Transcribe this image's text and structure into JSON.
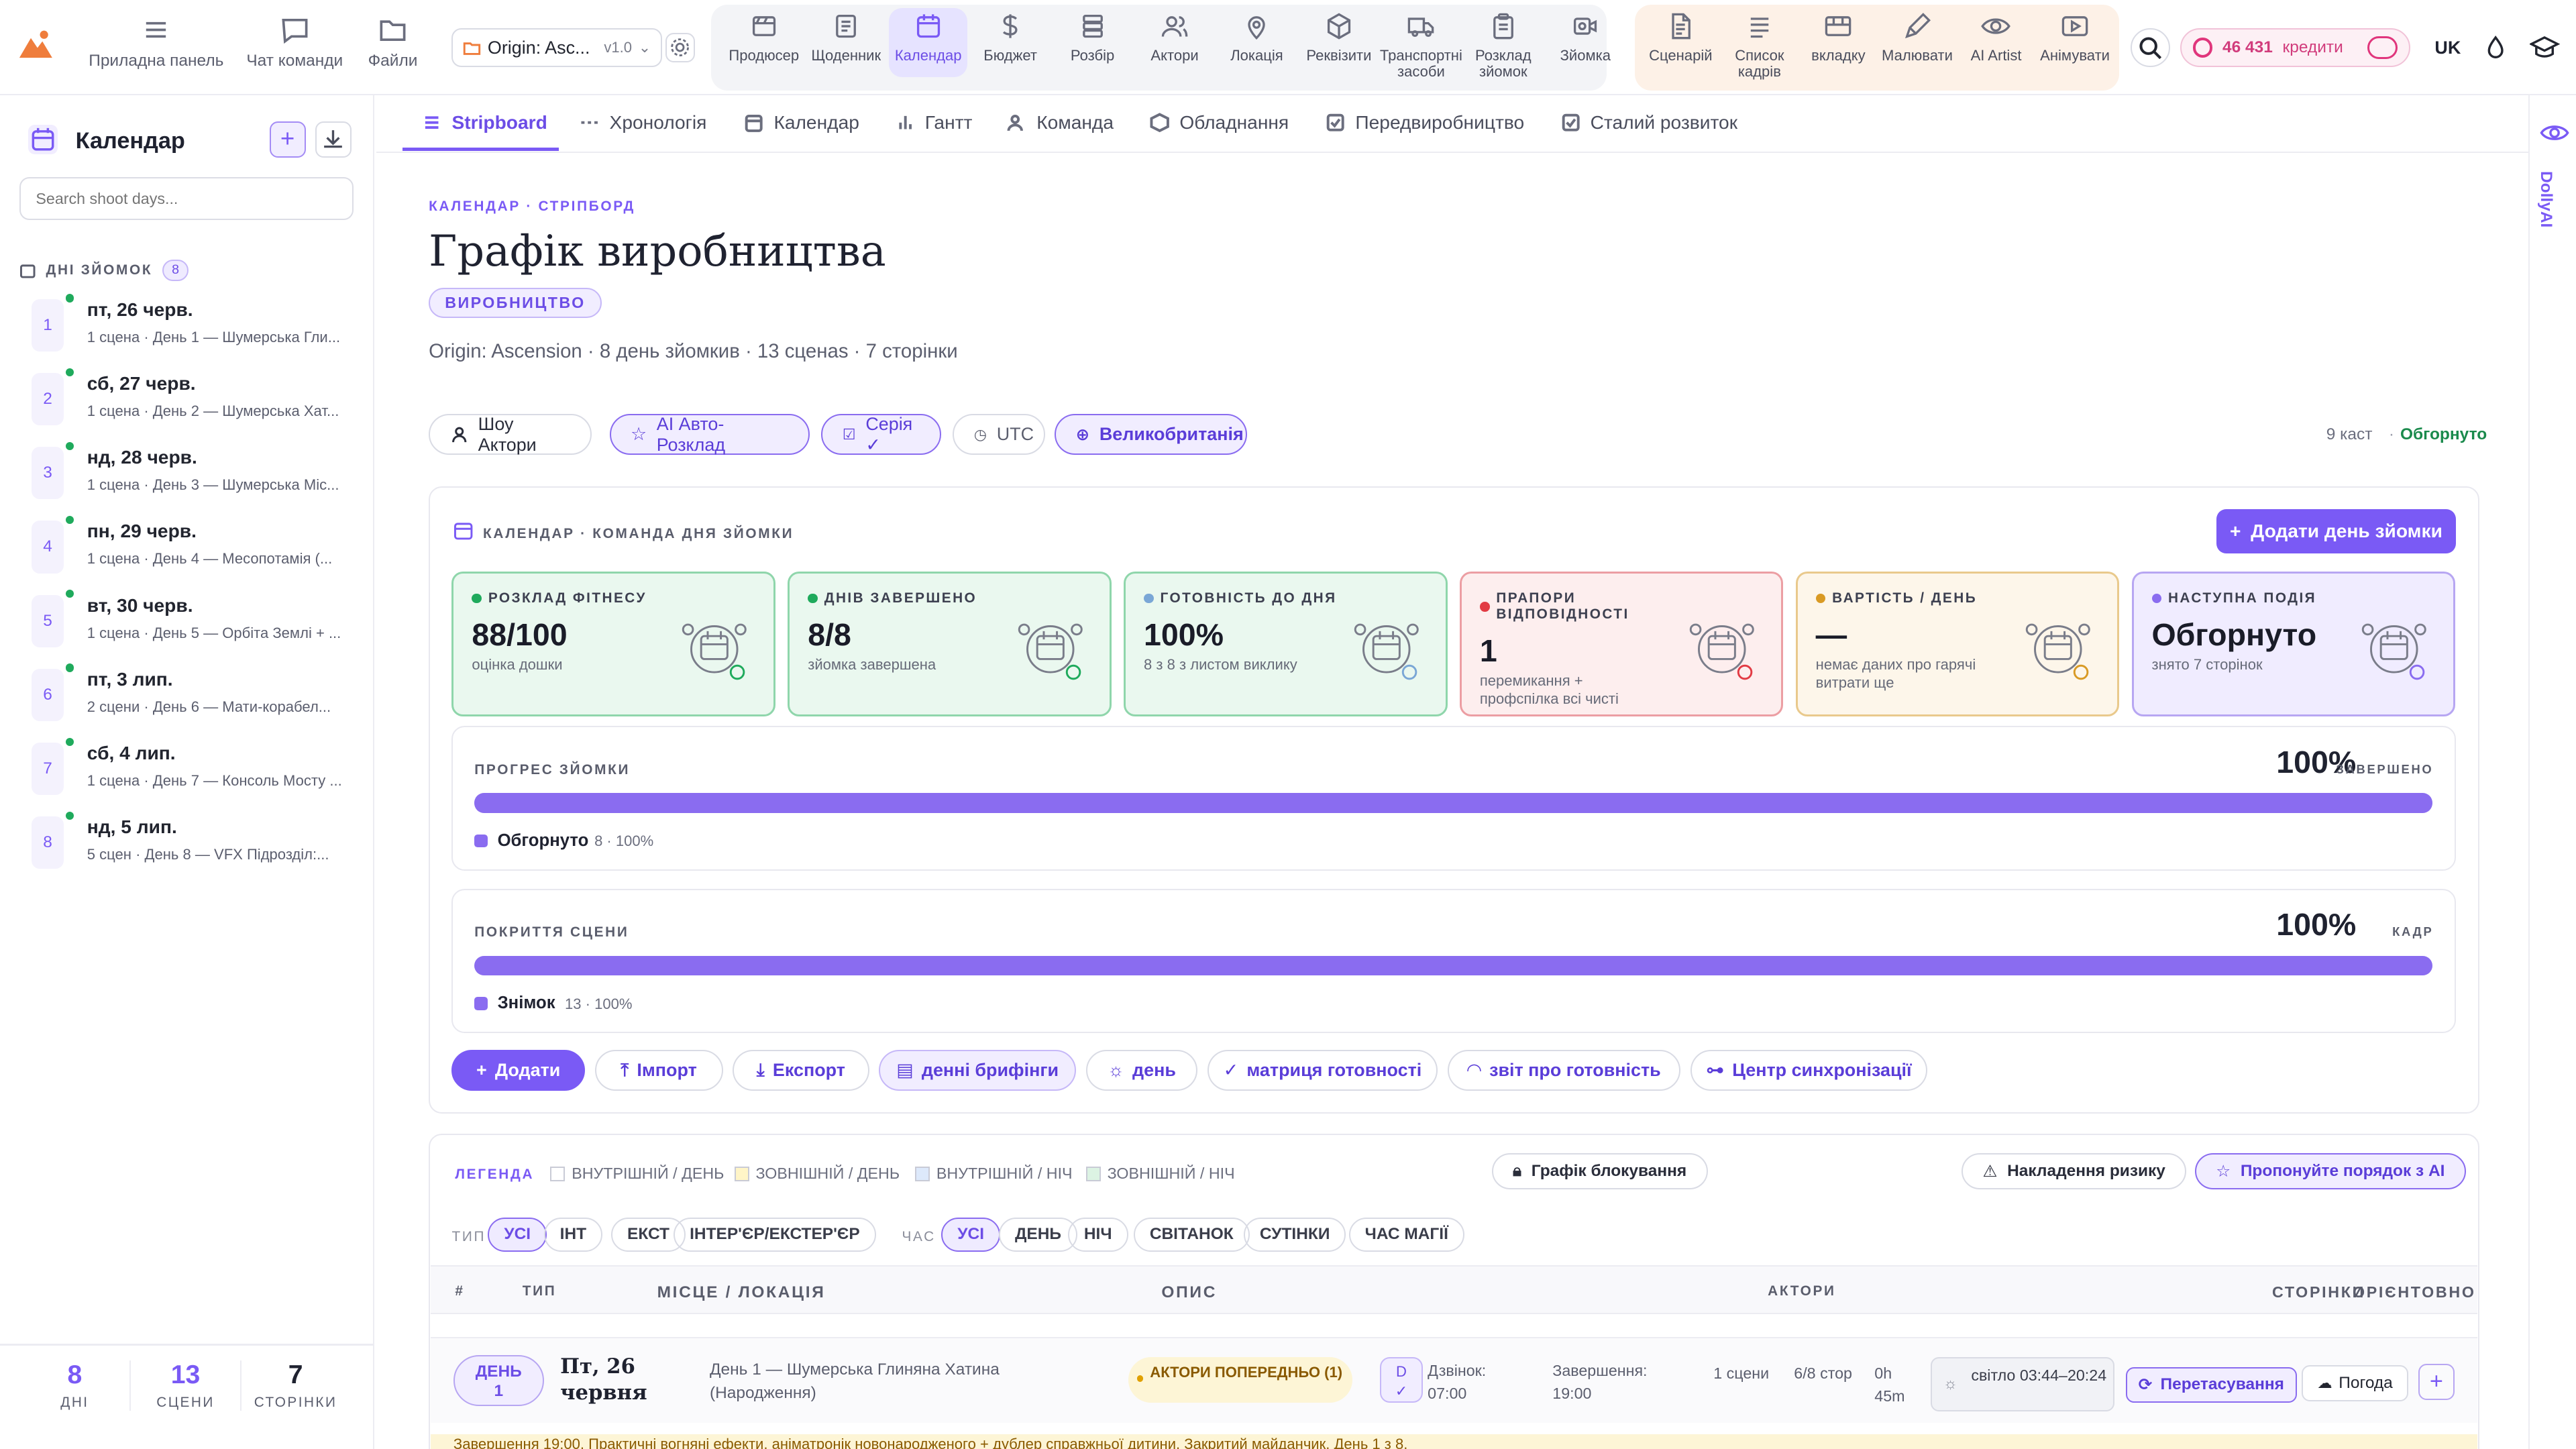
{
  "topbar": {
    "nav": [
      {
        "label": "Приладна панель",
        "icon": "menu-icon"
      },
      {
        "label": "Чат команди",
        "icon": "chat-icon"
      },
      {
        "label": "Файли",
        "icon": "folder-icon"
      }
    ],
    "project": {
      "name": "Origin: Asc...",
      "version": "v1.0"
    },
    "tools": [
      {
        "label": "Продюсер",
        "icon": "producer-icon"
      },
      {
        "label": "Щоденник",
        "icon": "journal-icon"
      },
      {
        "label": "Календар",
        "icon": "calendar-icon"
      },
      {
        "label": "Бюджет",
        "icon": "dollar-icon"
      },
      {
        "label": "Розбір",
        "icon": "breakdown-icon"
      },
      {
        "label": "Актори",
        "icon": "people-icon"
      },
      {
        "label": "Локація",
        "icon": "pin-icon"
      },
      {
        "label": "Реквізити",
        "icon": "box-icon"
      },
      {
        "label": "Транспортні засоби",
        "icon": "truck-icon"
      },
      {
        "label": "Розклад зйомок",
        "icon": "clipboard-icon"
      },
      {
        "label": "Зйомка",
        "icon": "camera-icon"
      }
    ],
    "writing": [
      {
        "label": "Сценарій",
        "icon": "script-icon"
      },
      {
        "label": "Список кадрів",
        "icon": "list-icon"
      },
      {
        "label": "вкладку",
        "icon": "storyboard-icon"
      },
      {
        "label": "Малювати",
        "icon": "pencil-icon"
      },
      {
        "label": "AI Artist",
        "icon": "eye-icon"
      },
      {
        "label": "Анімувати",
        "icon": "play-icon"
      }
    ],
    "credits": "46 431",
    "credits_label": "кредити",
    "lang": "UK"
  },
  "sidebar": {
    "title": "Календар",
    "search_placeholder": "Search shoot days...",
    "section": "ДНІ ЗЙОМОК",
    "count": "8",
    "days": [
      {
        "n": "1",
        "date": "пт, 26 черв.",
        "desc": "1 сцена · День 1 — Шумерська Гли..."
      },
      {
        "n": "2",
        "date": "сб, 27 черв.",
        "desc": "1 сцена · День 2 — Шумерська Хат..."
      },
      {
        "n": "3",
        "date": "нд, 28 черв.",
        "desc": "1 сцена · День 3 — Шумерська Міс..."
      },
      {
        "n": "4",
        "date": "пн, 29 черв.",
        "desc": "1 сцена · День 4 — Месопотамія (..."
      },
      {
        "n": "5",
        "date": "вт, 30 черв.",
        "desc": "1 сцена · День 5 — Орбіта Землі + ..."
      },
      {
        "n": "6",
        "date": "пт, 3 лип.",
        "desc": "2 сцени · День 6 — Мати-корабел..."
      },
      {
        "n": "7",
        "date": "сб, 4 лип.",
        "desc": "1 сцена · День 7 — Консоль Мосту ..."
      },
      {
        "n": "8",
        "date": "нд, 5 лип.",
        "desc": "5 сцен · День 8 — VFX Підрозділ:..."
      }
    ],
    "stats": [
      {
        "v": "8",
        "l": "ДНІ"
      },
      {
        "v": "13",
        "l": "СЦЕНИ"
      },
      {
        "v": "7",
        "l": "СТОРІНКИ"
      }
    ]
  },
  "tabs": [
    {
      "label": "Stripboard",
      "icon": "stripboard-icon"
    },
    {
      "label": "Хронологія",
      "icon": "dots-icon"
    },
    {
      "label": "Календар",
      "icon": "calendar-icon"
    },
    {
      "label": "Гантт",
      "icon": "bars-icon"
    },
    {
      "label": "Команда",
      "icon": "people-icon"
    },
    {
      "label": "Обладнання",
      "icon": "box-icon"
    },
    {
      "label": "Передвиробництво",
      "icon": "check-icon"
    },
    {
      "label": "Сталий розвиток",
      "icon": "check-icon"
    }
  ],
  "header": {
    "eyebrow": "КАЛЕНДАР · СТРІПБОРД",
    "title": "Графік виробництва",
    "badge": "ВИРОБНИЦТВО",
    "meta": "Origin: Ascension · 8 день зйомкив · 13 сценаs · 7 сторінки"
  },
  "controls": {
    "cast": "Шоу Актори",
    "auto": "AI Авто-Розклад",
    "series": "Серія ✓",
    "utc": "UTC",
    "region": "Великобританія",
    "cast_count": "9 каст",
    "status": "Обгорнуто"
  },
  "panel": {
    "title": "КАЛЕНДАР · КОМАНДА ДНЯ ЗЙОМКИ",
    "add": "Додати день зйомки"
  },
  "kpis": [
    {
      "h": "РОЗКЛАД ФІТНЕСУ",
      "v": "88/100",
      "s": "оцінка дошки",
      "bg": "#eaf8ef",
      "bd": "#8fd6ab",
      "dot": "#1faa5c"
    },
    {
      "h": "ДНІВ ЗАВЕРШЕНО",
      "v": "8/8",
      "s": "зйомка завершена",
      "bg": "#eaf8ef",
      "bd": "#8fd6ab",
      "dot": "#1faa5c"
    },
    {
      "h": "ГОТОВНІСТЬ ДО ДНЯ",
      "v": "100%",
      "s": "8 з 8 з листом виклику",
      "bg": "#eaf8ef",
      "bd": "#8fd6ab",
      "dot": "#7aa7d6"
    },
    {
      "h": "ПРАПОРИ ВІДПОВІДНОСТІ",
      "v": "1",
      "s": "перемикання + профспілка всі чисті",
      "bg": "#fdeeee",
      "bd": "#ec9ea3",
      "dot": "#e23b44"
    },
    {
      "h": "ВАРТІСТЬ / ДЕНЬ",
      "v": "—",
      "s": "немає даних про гарячі витрати ще",
      "bg": "#fdf6ea",
      "bd": "#e9c98c",
      "dot": "#d99a24"
    },
    {
      "h": "НАСТУПНА ПОДІЯ",
      "v": "Обгорнуто",
      "s": "знято 7 сторінок",
      "bg": "#f0ecff",
      "bd": "#b7a6f2",
      "dot": "#8a6cf0"
    }
  ],
  "progress": [
    {
      "label": "ПРОГРЕС ЗЙОМКИ",
      "pct": "100%",
      "suffix": "ЗАВЕРШЕНО",
      "legend": "Обгорнуто",
      "legend_meta": "8 · 100%",
      "value": 1.0
    },
    {
      "label": "ПОКРИТТЯ СЦЕНИ",
      "pct": "100%",
      "suffix": "КАДР",
      "legend": "Знімок",
      "legend_meta": "13 · 100%",
      "value": 1.0
    }
  ],
  "actions": [
    {
      "label": "Додати",
      "icon": "plus-icon"
    },
    {
      "label": "Імпорт",
      "icon": "upload-icon"
    },
    {
      "label": "Експорт",
      "icon": "download-icon"
    },
    {
      "label": "денні брифінги",
      "icon": "clipboard-icon"
    },
    {
      "label": "день",
      "icon": "sun-icon"
    },
    {
      "label": "матриця готовності",
      "icon": "check-circle-icon"
    },
    {
      "label": "звіт про готовність",
      "icon": "gauge-icon"
    },
    {
      "label": "Центр синхронізації",
      "icon": "link-icon"
    }
  ],
  "legend": {
    "title": "ЛЕГЕНДА",
    "items": [
      {
        "l": "ВНУТРІШНІЙ / ДЕНЬ",
        "c": "#ffffff"
      },
      {
        "l": "ЗОВНІШНІЙ / ДЕНЬ",
        "c": "#fff5c7"
      },
      {
        "l": "ВНУТРІШНІЙ / НІЧ",
        "c": "#dde9fb"
      },
      {
        "l": "ЗОВНІШНІЙ / НІЧ",
        "c": "#dcf3e3"
      }
    ],
    "block": "Графік блокування",
    "risk": "Накладення ризику",
    "suggest": "Пропонуйте порядок з AI"
  },
  "filters": {
    "type_label": "ТИП",
    "types": [
      "УСІ",
      "ІНТ",
      "ЕКСТ",
      "ІНТЕР'ЄР/ЕКСТЕР'ЄР"
    ],
    "time_label": "ЧАС",
    "times": [
      "УСІ",
      "ДЕНЬ",
      "НІЧ",
      "СВІТАНОК",
      "СУТІНКИ",
      "ЧАС МАГІЇ"
    ]
  },
  "table": {
    "cols": [
      "#",
      "ТИП",
      "МІСЦЕ / ЛОКАЦІЯ",
      "ОПИС",
      "АКТОРИ",
      "СТОРІНКИ",
      "ОРІЄНТОВНО"
    ]
  },
  "row": {
    "day": "ДЕНЬ",
    "day_n": "1",
    "date": "Пт, 26 червня",
    "location": "День 1 — Шумерська Глиняна Хатина (Народження)",
    "warn": "АКТОРИ ПОПЕРЕДНЬО (1)",
    "badge": "D",
    "call": "Дзвінок:",
    "call_t": "07:00",
    "wrap": "Завершення:",
    "wrap_t": "19:00",
    "scenes": "1 сцени",
    "pages": "6/8 стор",
    "dur": "0h 45m",
    "light": "світло 03:44–20:24",
    "reshuffle": "Перетасування",
    "weather": "Погода",
    "note": "Завершення 19:00. Практичні вогняні ефекти, аніматронік новонародженого + дублер справжньої дитини. Закритий майданчик. День 1 з 8."
  },
  "rail": {
    "label": "DollyAI"
  }
}
